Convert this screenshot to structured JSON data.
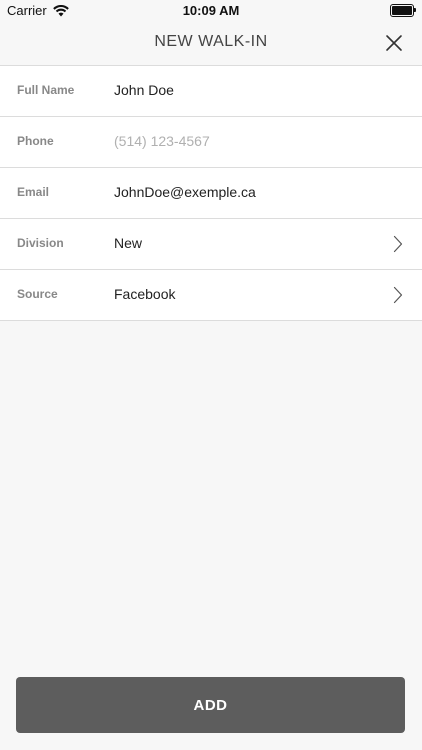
{
  "status_bar": {
    "carrier": "Carrier",
    "time": "10:09 AM",
    "battery_level": 1.0
  },
  "header": {
    "title": "NEW WALK-IN",
    "close_icon": "close-icon"
  },
  "form": {
    "full_name": {
      "label": "Full Name",
      "value": "John Doe"
    },
    "phone": {
      "label": "Phone",
      "placeholder": "(514) 123-4567"
    },
    "email": {
      "label": "Email",
      "value": "JohnDoe@exemple.ca"
    },
    "division": {
      "label": "Division",
      "value": "New"
    },
    "source": {
      "label": "Source",
      "value": "Facebook"
    }
  },
  "footer": {
    "add_label": "ADD"
  },
  "colors": {
    "background": "#f7f7f7",
    "button": "#5d5d5d",
    "divider": "#dcdcdc",
    "label": "#888888"
  }
}
